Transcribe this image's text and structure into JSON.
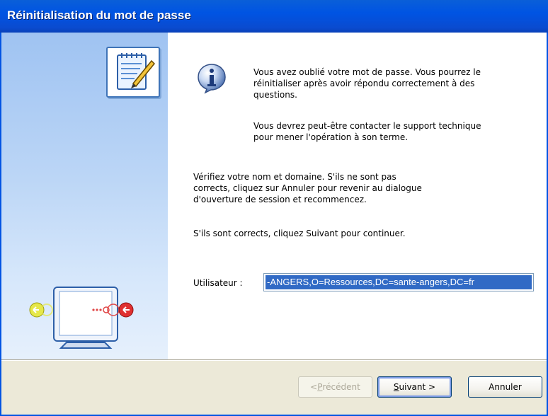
{
  "window": {
    "title": "Réinitialisation du mot de passe"
  },
  "content": {
    "info_paragraph_1": [
      "Vous avez oublié votre mot de passe. Vous pourrez le",
      "réinitialiser après avoir répondu correctement à des",
      "questions."
    ],
    "info_paragraph_2": [
      "Vous devrez peut-être contacter le support technique",
      "pour mener l'opération à son terme."
    ],
    "verify_paragraph": [
      "Vérifiez votre nom et domaine. S'ils ne sont pas",
      "corrects, cliquez sur Annuler pour revenir au dialogue",
      "d'ouverture de session et recommencez."
    ],
    "continue_paragraph": "S'ils sont corrects, cliquez Suivant pour continuer.",
    "user_label": "Utilisateur :",
    "user_value": "-ANGERS,O=Ressources,DC=sante-angers,DC=fr"
  },
  "buttons": {
    "previous_prefix": "< ",
    "previous_accel": "P",
    "previous_rest": "récédent",
    "next_accel": "S",
    "next_rest": "uivant >",
    "cancel": "Annuler"
  },
  "icons": {
    "notepad": "notepad-pen-icon",
    "info": "info-icon",
    "monitor": "monitor-icon",
    "arrow_left": "yellow-arrow-icon",
    "arrow_right": "red-arrow-icon"
  },
  "colors": {
    "titlebar": "#0054e3",
    "selection": "#316ac5",
    "sidebar": "#bcd6f6",
    "dialog_bg": "#ece9d8"
  }
}
